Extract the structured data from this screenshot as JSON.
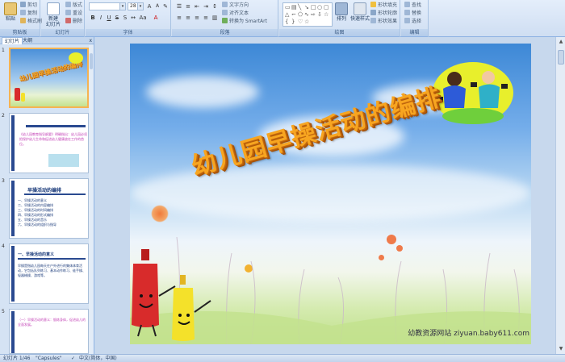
{
  "ribbon": {
    "clipboard": {
      "label": "剪贴板",
      "paste": "粘贴",
      "cut": "剪切",
      "copy": "复制",
      "format_painter": "格式刷"
    },
    "slides": {
      "label": "幻灯片",
      "new_slide": "新建\n幻灯片",
      "layout": "版式",
      "reset": "重设",
      "delete": "删除"
    },
    "font": {
      "label": "字体",
      "font_name": "",
      "font_size": "28"
    },
    "paragraph": {
      "label": "段落",
      "text_direction": "文字方向",
      "align_text": "对齐文本",
      "smartart": "转换为 SmartArt"
    },
    "drawing": {
      "label": "绘图",
      "arrange": "排列",
      "quick_styles": "快速样式",
      "shape_fill": "形状填充",
      "shape_outline": "形状轮廓",
      "shape_effects": "形状效果"
    },
    "editing": {
      "label": "编辑",
      "find": "查找",
      "replace": "替换",
      "select": "选择"
    }
  },
  "left_panel": {
    "tabs": [
      "幻灯片",
      "大纲"
    ],
    "close": "x",
    "slides": [
      {
        "num": "1",
        "title": "幼儿园早操活动的编排"
      },
      {
        "num": "2",
        "text": "《幼儿园教育指导纲要》明确指出：幼儿园必须把保护幼儿生命和促进幼儿健康放在工作的首位。"
      },
      {
        "num": "3",
        "title": "早操活动的编排",
        "items": [
          "一、早操活动的意义",
          "二、早操活动的内容编排",
          "三、早操活动的时间编排",
          "四、早操活动的形式编排",
          "五、早操活动的音乐",
          "六、早操活动的组织与指导"
        ]
      },
      {
        "num": "4",
        "title": "一、早操活动的意义",
        "text": "早操是指幼儿园每天在户外进行的集体体育活动，它包括队列练习、基本动作练习、徒手操、轻器械操、游戏等。"
      },
      {
        "num": "5",
        "text": "（一）早操活动的意义：锻炼身体，促进幼儿的全面发展。"
      }
    ]
  },
  "slide": {
    "title": "幼儿园早操活动的编排",
    "watermark": "幼教资源网站 ziyuan.baby611.com"
  },
  "status": {
    "slide_info": "幻灯片 1/46",
    "theme": "\"Capsules\"",
    "language": "中文(简体，中国)"
  },
  "colors": {
    "ribbon_bg": "#cfdef2",
    "title": "#f7a520",
    "selection": "#f6b352"
  }
}
